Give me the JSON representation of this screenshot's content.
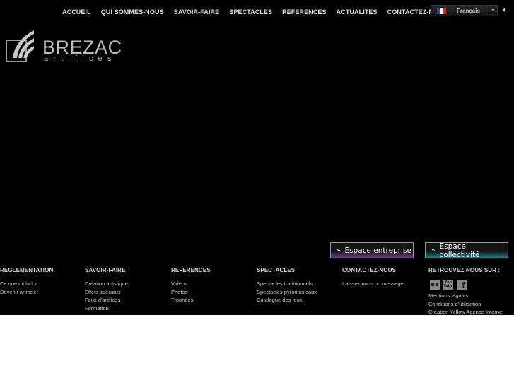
{
  "nav": {
    "items": [
      "ACCUEIL",
      "QUI SOMMES-NOUS",
      "SAVOIR-FAIRE",
      "SPECTACLES",
      "REFERENCES",
      "ACTUALITES",
      "CONTACTEZ-NOUS"
    ]
  },
  "language": {
    "selected": "Français",
    "flag_colors": [
      "#2b3f9e",
      "#ffffff",
      "#d62a2a"
    ]
  },
  "icons": {
    "sound": "speaker-icon",
    "flickr": "flickr-icon",
    "youtube": "youtube-icon",
    "facebook": "facebook-icon"
  },
  "logo": {
    "brand": "BREZAC",
    "sub": "artifices"
  },
  "espace": {
    "entreprise": "Espace entreprise",
    "collectivite": "Espace collectivité",
    "entreprise_color": "#6a3b88",
    "collectivite_color": "#1d7f88"
  },
  "footer": {
    "columns": [
      {
        "title": "REGLEMENTATION",
        "items": [
          "Ce que dit la loi",
          "Devenir artificier"
        ]
      },
      {
        "title": "SAVOIR-FAIRE",
        "items": [
          "Création artistique",
          "Effets spéciaux",
          "Feux d'artifices",
          "Formation"
        ]
      },
      {
        "title": "REFERENCES",
        "items": [
          "Vidéos",
          "Photos",
          "Trophées"
        ]
      },
      {
        "title": "SPECTACLES",
        "items": [
          "Spectacles traditionnels",
          "Spectacles pyromusicaux",
          "Catalogue des feux"
        ]
      },
      {
        "title": "CONTACTEZ-NOUS",
        "items": [
          "Laissez nous un message"
        ]
      },
      {
        "title": "RETROUVEZ-NOUS SUR :",
        "items": [
          "Mentions légales",
          "Conditions d'utilisation",
          "Création Yellow Agence Internet"
        ]
      }
    ],
    "youtube_label": "You Tube",
    "facebook_label": "f"
  }
}
